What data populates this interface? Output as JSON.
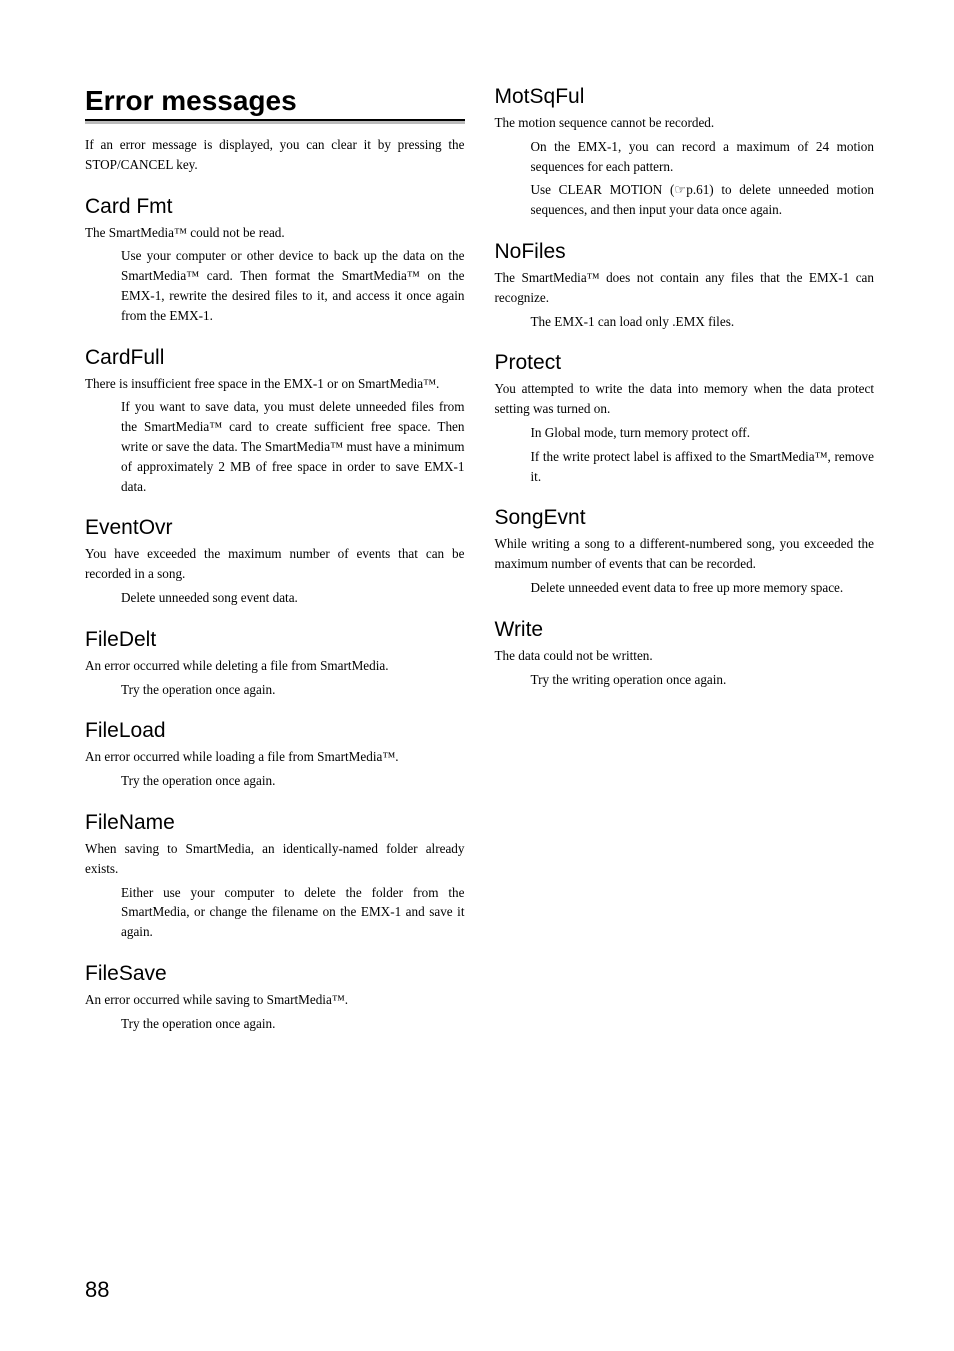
{
  "title": "Error messages",
  "intro": "If an error message is displayed, you can clear it by pressing the STOP/CANCEL key.",
  "leftSections": [
    {
      "heading": "Card Fmt",
      "desc": "The SmartMedia™ could not be read.",
      "advice": "Use your computer or other device to back up the data on the SmartMedia™ card. Then format the SmartMedia™ on the EMX-1, rewrite the desired files to it, and access it once again from the EMX-1."
    },
    {
      "heading": "CardFull",
      "desc": "There is insufficient free space in the EMX-1 or on SmartMedia™.",
      "advice": "If you want to save data, you must delete unneeded files from the SmartMedia™ card to create sufficient free space. Then write or save the data. The SmartMedia™ must have a minimum of approximately 2 MB of free space in order to save EMX-1 data."
    },
    {
      "heading": "EventOvr",
      "desc": "You have exceeded the maximum number of events that can be recorded in a song.",
      "advice": "Delete unneeded song event data."
    },
    {
      "heading": "FileDelt",
      "desc": "An error occurred while deleting a file from SmartMedia.",
      "advice": "Try the operation once again."
    },
    {
      "heading": "FileLoad",
      "desc": "An error occurred while loading a file from SmartMedia™.",
      "advice": "Try the operation once again."
    },
    {
      "heading": "FileName",
      "desc": "When saving to SmartMedia, an identically-named folder already exists.",
      "advice": " Either use your computer to delete the folder from the SmartMedia, or change the filename on the EMX-1 and save it again."
    },
    {
      "heading": "FileSave",
      "desc": "An error occurred while saving to SmartMedia™.",
      "advice": "Try the operation once again."
    }
  ],
  "rightSections": [
    {
      "heading": "MotSqFul",
      "desc": "The motion sequence cannot be recorded.",
      "advice1": "On the EMX-1, you can record a maximum of 24 motion sequences for each pattern.",
      "advice2_pre": "Use CLEAR MOTION (",
      "advice2_ref": "☞",
      "advice2_post": "p.61) to delete unneeded motion sequences, and then input your data once again."
    },
    {
      "heading": "NoFiles",
      "desc": "The SmartMedia™ does not contain any files that the EMX-1 can recognize.",
      "advice": "The EMX-1 can load only .EMX files."
    },
    {
      "heading": "Protect",
      "desc": "You attempted to write the data into memory when the data protect setting was turned on.",
      "advice1": "In Global mode, turn memory protect off.",
      "advice2": "If the write protect label is affixed to the SmartMedia™, remove it."
    },
    {
      "heading": "SongEvnt",
      "desc": "While writing a song to a different-numbered song, you exceeded the maximum number of events that can be recorded.",
      "advice": "Delete unneeded event data to free up more memory space."
    },
    {
      "heading": "Write",
      "desc": "The data could not be written.",
      "advice": "Try the writing operation once again."
    }
  ],
  "pageNumber": "88"
}
